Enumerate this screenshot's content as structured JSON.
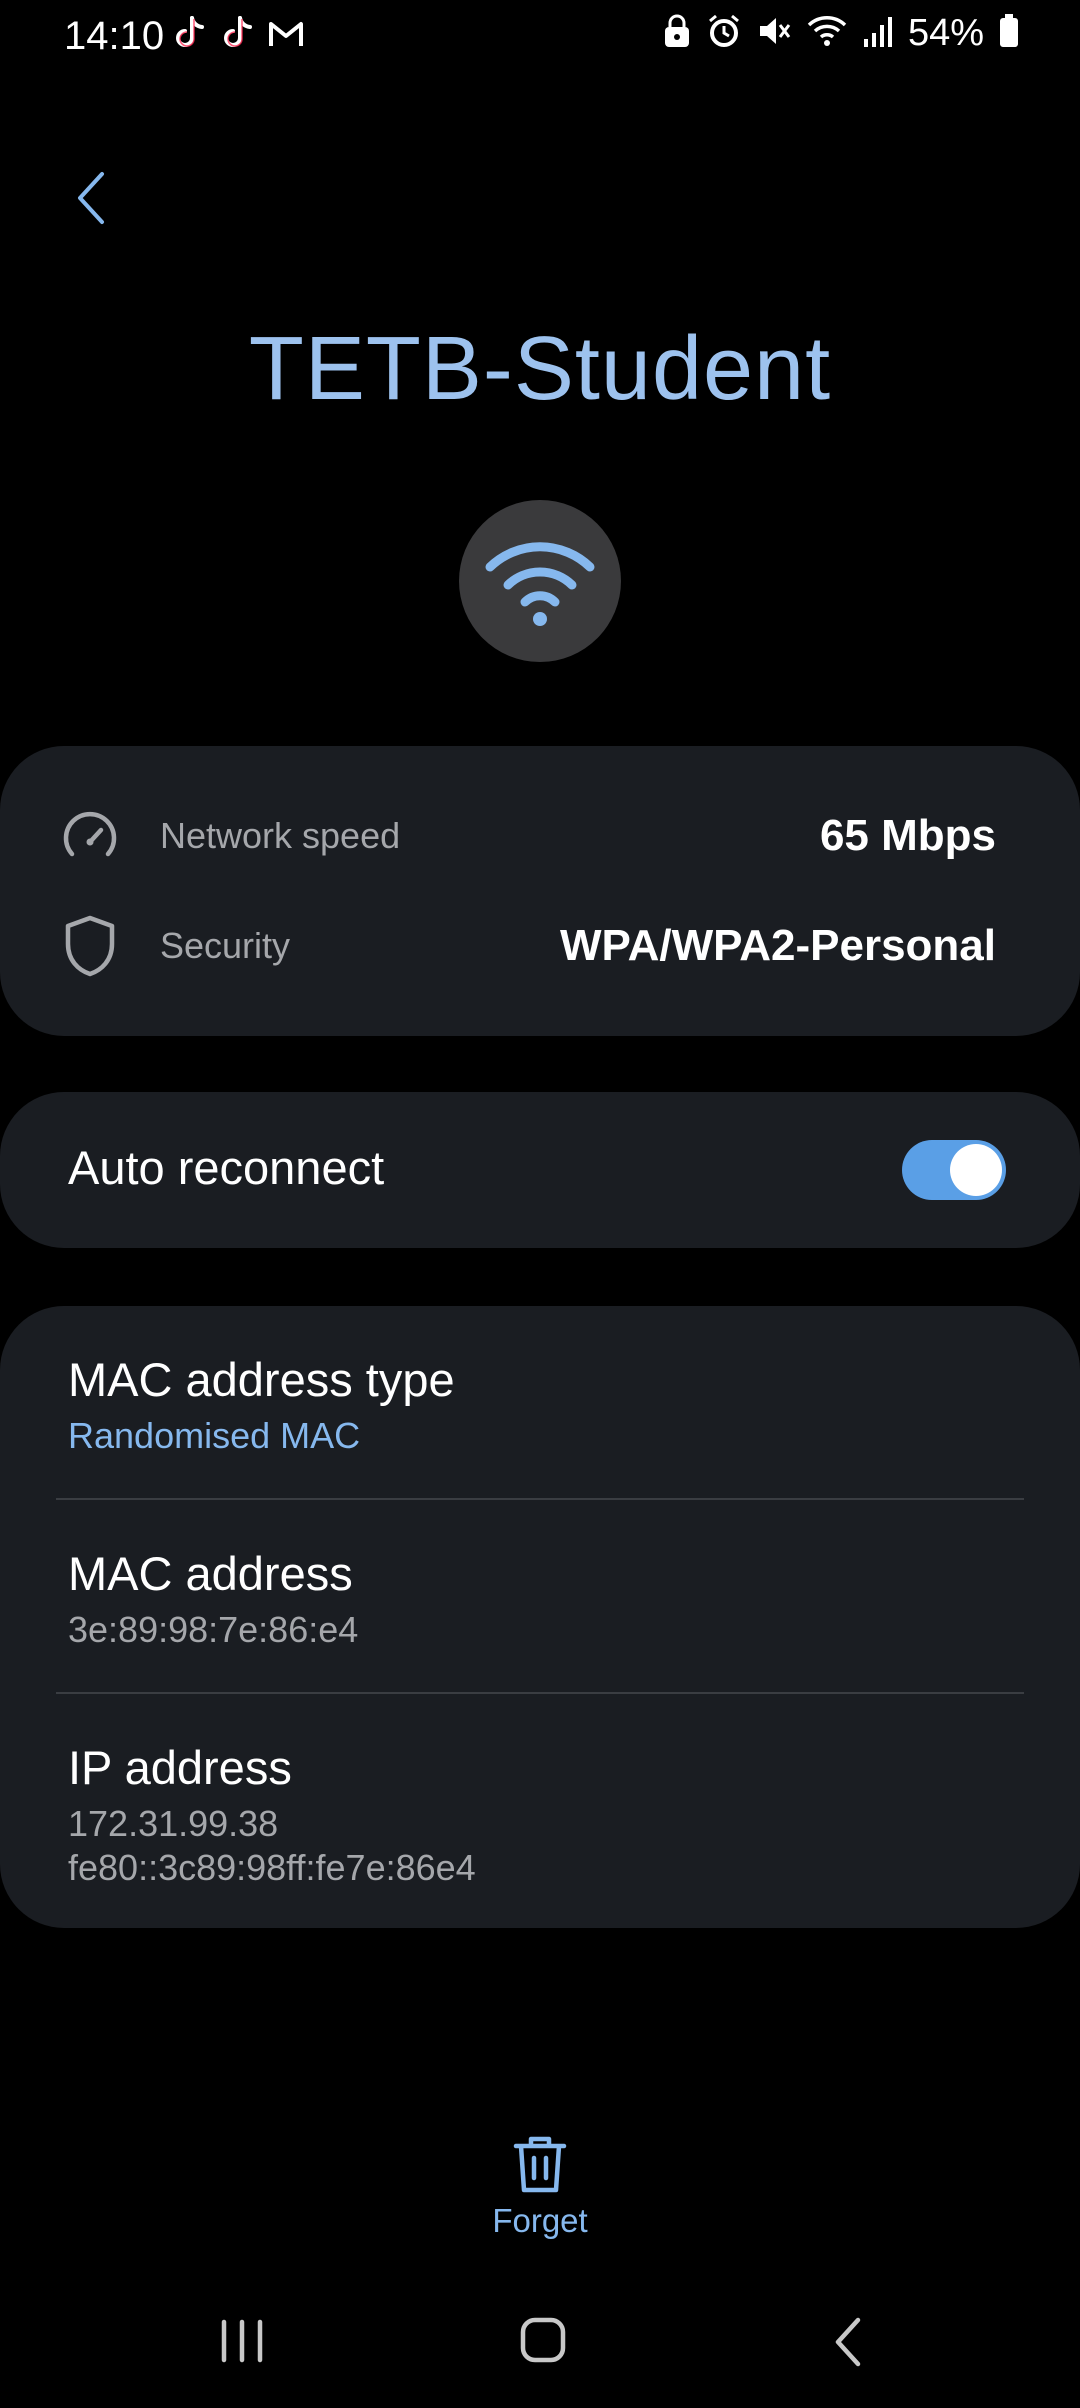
{
  "status_bar": {
    "time": "14:10",
    "battery_percent": "54%",
    "left_icons": [
      "tiktok-icon",
      "tiktok-icon",
      "gmail-icon"
    ],
    "right_icons": [
      "lock-icon",
      "alarm-icon",
      "mute-icon",
      "wifi-icon",
      "signal-icon",
      "battery-icon"
    ]
  },
  "header": {
    "network_name": "TETB-Student"
  },
  "details": {
    "speed_label": "Network speed",
    "speed_value": "65 Mbps",
    "security_label": "Security",
    "security_value": "WPA/WPA2-Personal"
  },
  "auto_reconnect": {
    "label": "Auto reconnect",
    "enabled": true
  },
  "network_info": {
    "mac_type_label": "MAC address type",
    "mac_type_value": "Randomised MAC",
    "mac_label": "MAC address",
    "mac_value": "3e:89:98:7e:86:e4",
    "ip_label": "IP address",
    "ip_v4": "172.31.99.38",
    "ip_v6": "fe80::3c89:98ff:fe7e:86e4"
  },
  "actions": {
    "forget_label": "Forget"
  },
  "colors": {
    "accent": "#86b8ee",
    "title": "#9dc2ee",
    "card_bg": "#1a1d22",
    "toggle_on": "#5a9fe6"
  }
}
